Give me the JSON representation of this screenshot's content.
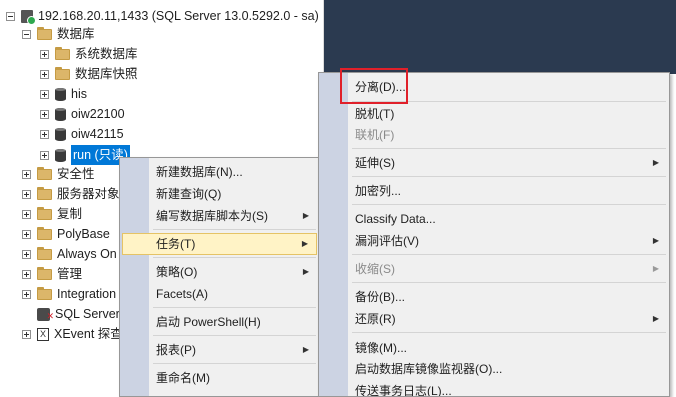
{
  "tree": {
    "server": "192.168.20.11,1433 (SQL Server 13.0.5292.0 - sa)",
    "databases": "数据库",
    "system_dbs": "系统数据库",
    "snapshots": "数据库快照",
    "db_his": "his",
    "db_oiw22100": "oiw22100",
    "db_oiw42115": "oiw42115",
    "db_run": "run (只读)",
    "security": "安全性",
    "server_objects": "服务器对象",
    "replication": "复制",
    "polybase": "PolyBase",
    "always_on": "Always On",
    "management": "管理",
    "integration": "Integration",
    "sql_agent": "SQL Server",
    "xevent": "XEvent 探查"
  },
  "menu1": {
    "new_db": "新建数据库(N)...",
    "new_query": "新建查询(Q)",
    "script_db": "编写数据库脚本为(S)",
    "tasks": "任务(T)",
    "policies": "策略(O)",
    "facets": "Facets(A)",
    "powershell": "启动 PowerShell(H)",
    "reports": "报表(P)",
    "rename": "重命名(M)"
  },
  "menu2": {
    "detach": "分离(D)...",
    "take_offline": "脱机(T)",
    "bring_online": "联机(F)",
    "stretch": "延伸(S)",
    "encrypt_columns": "加密列...",
    "classify": "Classify Data...",
    "vulnerability": "漏洞评估(V)",
    "shrink": "收缩(S)",
    "backup": "备份(B)...",
    "restore": "还原(R)",
    "mirror": "镜像(M)...",
    "mirror_monitor": "启动数据库镜像监视器(O)...",
    "log_shipping": "传送事务日志(L)..."
  },
  "icons": {
    "expand": "plus-icon",
    "collapse": "minus-icon",
    "submenu": "chevron-right-icon"
  },
  "colors": {
    "selection": "#0078d7",
    "highlight_row": "#fff3c6",
    "callout": "#e0202a",
    "panel": "#2b3a50"
  }
}
